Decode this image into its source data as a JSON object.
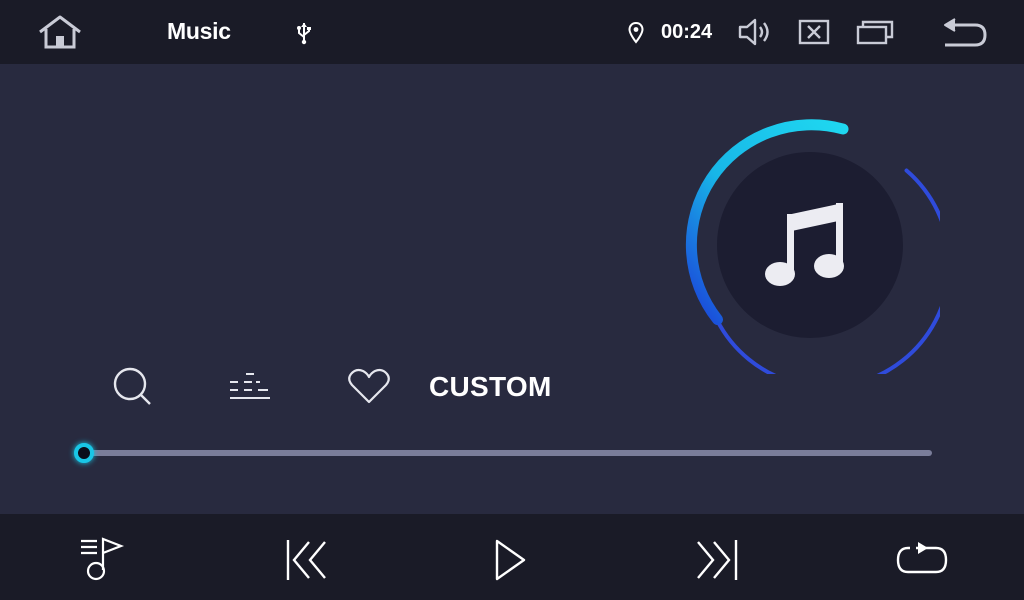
{
  "status_bar": {
    "title": "Music",
    "time": "00:24"
  },
  "controls": {
    "eq_preset_label": "CUSTOM"
  },
  "playback": {
    "progress": 0.0
  },
  "icons": {
    "home": "home-icon",
    "usb": "usb-icon",
    "location": "location-pin-icon",
    "volume": "volume-icon",
    "close": "close-icon",
    "windows": "recent-apps-icon",
    "back": "back-icon",
    "search": "search-icon",
    "equalizer": "equalizer-icon",
    "favorite": "heart-icon",
    "playlist": "playlist-icon",
    "previous": "skip-previous-icon",
    "play": "play-icon",
    "next": "skip-next-icon",
    "repeat": "repeat-icon",
    "album_art": "music-note-icon"
  },
  "colors": {
    "background": "#282a3f",
    "bar_background": "#1a1b27",
    "accent_cyan": "#19c6e6",
    "accent_blue": "#2f4bdb",
    "track": "#7a7d9a"
  }
}
